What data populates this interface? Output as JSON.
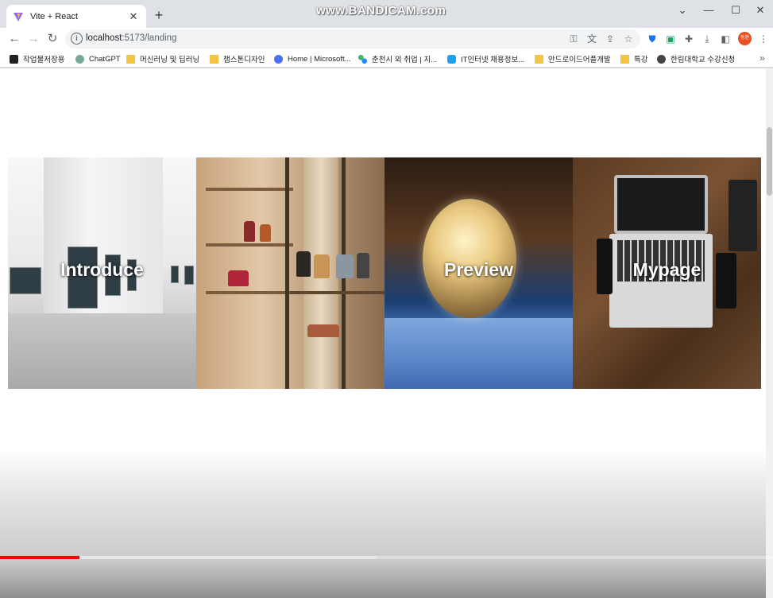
{
  "browser": {
    "tab_title": "Vite + React",
    "tab_close": "✕",
    "new_tab": "+",
    "watermark": "www.BANDICAM.com",
    "url_host": "localhost",
    "url_path": ":5173/landing",
    "window_controls": {
      "minimize": "—",
      "maximize": "☐",
      "close": "✕"
    },
    "profile_initials": "동현"
  },
  "bookmarks": [
    {
      "label": "작업물저장용",
      "icon": "notion-icon"
    },
    {
      "label": "ChatGPT",
      "icon": "chatgpt-icon"
    },
    {
      "label": "머신러닝 및 딥러닝",
      "icon": "folder-icon"
    },
    {
      "label": "챕스톤디자인",
      "icon": "folder-icon"
    },
    {
      "label": "Home | Microsoft...",
      "icon": "microsoft-icon"
    },
    {
      "label": "춘천시 외 취업 | 지...",
      "icon": "jobsite-icon"
    },
    {
      "label": "IT인터넷 채용정보...",
      "icon": "it-jobs-icon"
    },
    {
      "label": "안드로이드어플개발",
      "icon": "folder-icon"
    },
    {
      "label": "특강",
      "icon": "folder-icon"
    },
    {
      "label": "한림대학교 수강신청",
      "icon": "globe-icon"
    }
  ],
  "bookmarks_more": "»",
  "landing": {
    "panels": [
      {
        "label": "Introduce"
      },
      {
        "label": ""
      },
      {
        "label": "Preview"
      },
      {
        "label": "Mypage"
      }
    ]
  },
  "video": {
    "played_fraction": 0.103,
    "buffered_fraction": 0.488,
    "progress_color": "#ff0000"
  }
}
